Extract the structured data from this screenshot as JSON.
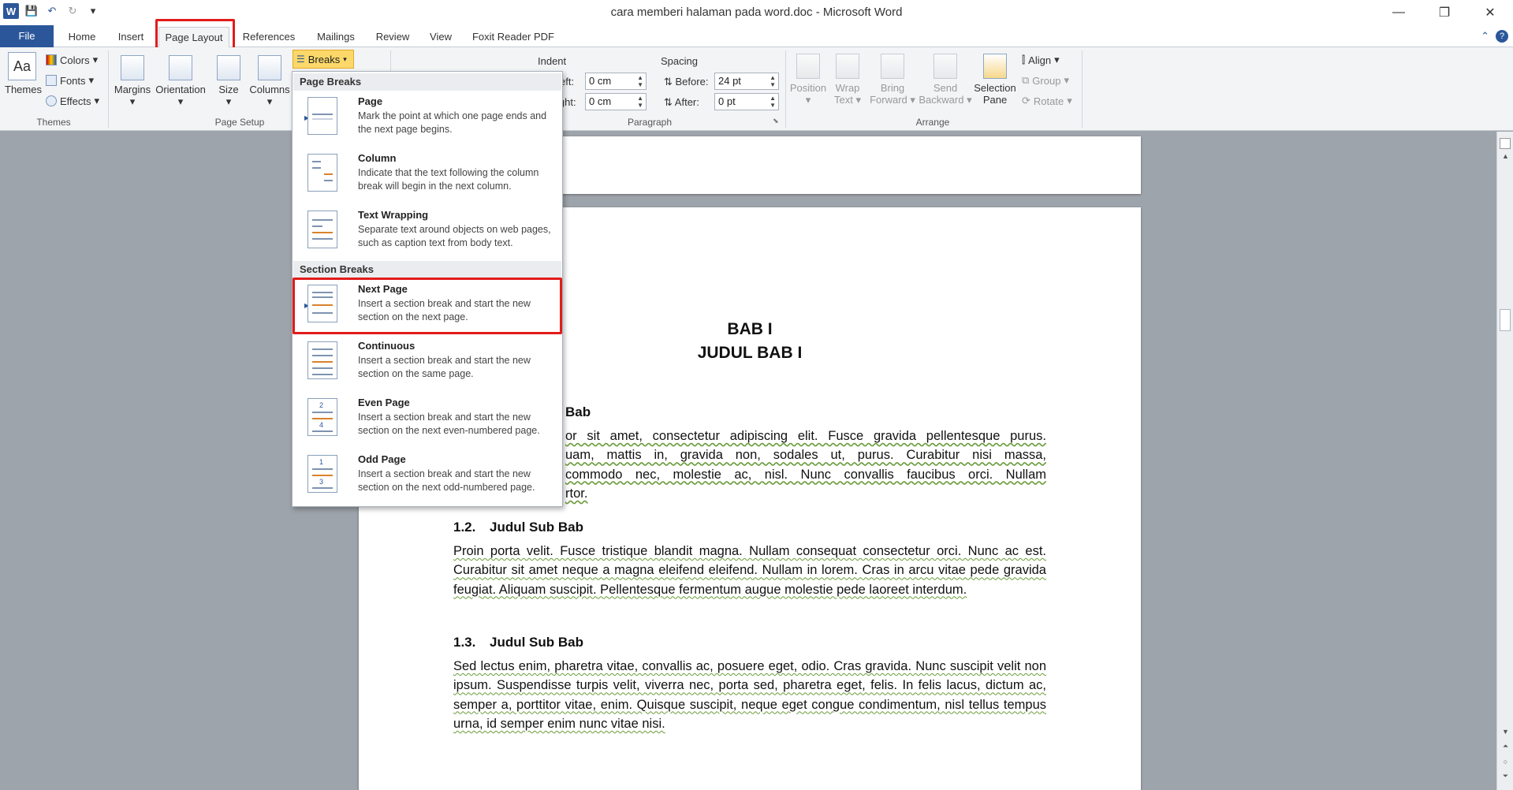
{
  "window": {
    "title": "cara memberi halaman pada word.doc  -  Microsoft Word",
    "minimize": "—",
    "restore": "❐",
    "close": "✕"
  },
  "qat": {
    "app": "W",
    "save": "💾",
    "undo": "↶",
    "redo": "↻",
    "customize": "▾"
  },
  "tabs": [
    "File",
    "Home",
    "Insert",
    "Page Layout",
    "References",
    "Mailings",
    "Review",
    "View",
    "Foxit Reader PDF"
  ],
  "ribbon": {
    "themes": {
      "themes_label": "Themes",
      "colors": "Colors",
      "fonts": "Fonts",
      "effects": "Effects",
      "group": "Themes"
    },
    "page_setup": {
      "margins": "Margins",
      "orientation": "Orientation",
      "size": "Size",
      "columns": "Columns",
      "breaks": "Breaks",
      "group": "Page Setup"
    },
    "paragraph": {
      "indent": "Indent",
      "left_label": "eft:",
      "left_value": "0 cm",
      "right_label": "ight:",
      "right_value": "0 cm",
      "spacing": "Spacing",
      "before_label": "Before:",
      "before_value": "24 pt",
      "after_label": "After:",
      "after_value": "0 pt",
      "group": "Paragraph"
    },
    "arrange": {
      "position": "Position",
      "wrap1": "Wrap",
      "wrap2": "Text",
      "bring1": "Bring",
      "bring2": "Forward",
      "send1": "Send",
      "send2": "Backward",
      "sel1": "Selection",
      "sel2": "Pane",
      "align": "Align",
      "group_btn": "Group",
      "rotate": "Rotate",
      "group": "Arrange"
    }
  },
  "breaks_menu": {
    "page_breaks": "Page Breaks",
    "section_breaks": "Section Breaks",
    "items": [
      {
        "title": "Page",
        "desc": "Mark the point at which one page ends and the next page begins."
      },
      {
        "title": "Column",
        "desc": "Indicate that the text following the column break will begin in the next column."
      },
      {
        "title": "Text Wrapping",
        "desc": "Separate text around objects on web pages, such as caption text from body text."
      },
      {
        "title": "Next Page",
        "desc": "Insert a section break and start the new section on the next page."
      },
      {
        "title": "Continuous",
        "desc": "Insert a section break and start the new section on the same page."
      },
      {
        "title": "Even Page",
        "desc": "Insert a section break and start the new section on the next even-numbered page."
      },
      {
        "title": "Odd Page",
        "desc": "Insert a section break and start the new section on the next odd-numbered page."
      }
    ]
  },
  "document": {
    "bab": "BAB I",
    "judul_bab": "JUDUL BAB I",
    "sub1": {
      "num": "",
      "title": "Bab"
    },
    "para1_lines": [
      "or sit amet, consectetur adipiscing elit. Fusce gravida pellentesque purus.",
      "uam, mattis in, gravida non, sodales ut, purus. Curabitur nisi massa,",
      "commodo nec, molestie ac, nisl. Nunc convallis faucibus orci. Nullam",
      "rtor."
    ],
    "sub2": {
      "num": "1.2.",
      "title": "Judul Sub Bab"
    },
    "para2": "Proin porta velit. Fusce tristique blandit magna. Nullam consequat consectetur orci. Nunc ac est. Curabitur sit amet neque a magna eleifend eleifend. Nullam in lorem. Cras in arcu vitae pede gravida feugiat. Aliquam suscipit. Pellentesque fermentum augue molestie pede laoreet interdum.",
    "sub3": {
      "num": "1.3.",
      "title": "Judul Sub Bab"
    },
    "para3": "Sed lectus enim, pharetra vitae, convallis ac, posuere eget, odio. Cras gravida. Nunc suscipit velit non ipsum. Suspendisse turpis velit, viverra nec, porta sed, pharetra eget, felis. In felis lacus, dictum ac, semper a, porttitor vitae, enim. Quisque suscipit, neque eget congue condimentum, nisl tellus tempus urna, id semper enim nunc vitae nisi."
  },
  "colors": {
    "accent": "#2b579a",
    "highlight": "#e21b1b",
    "breaks_active": "#fbd869"
  }
}
